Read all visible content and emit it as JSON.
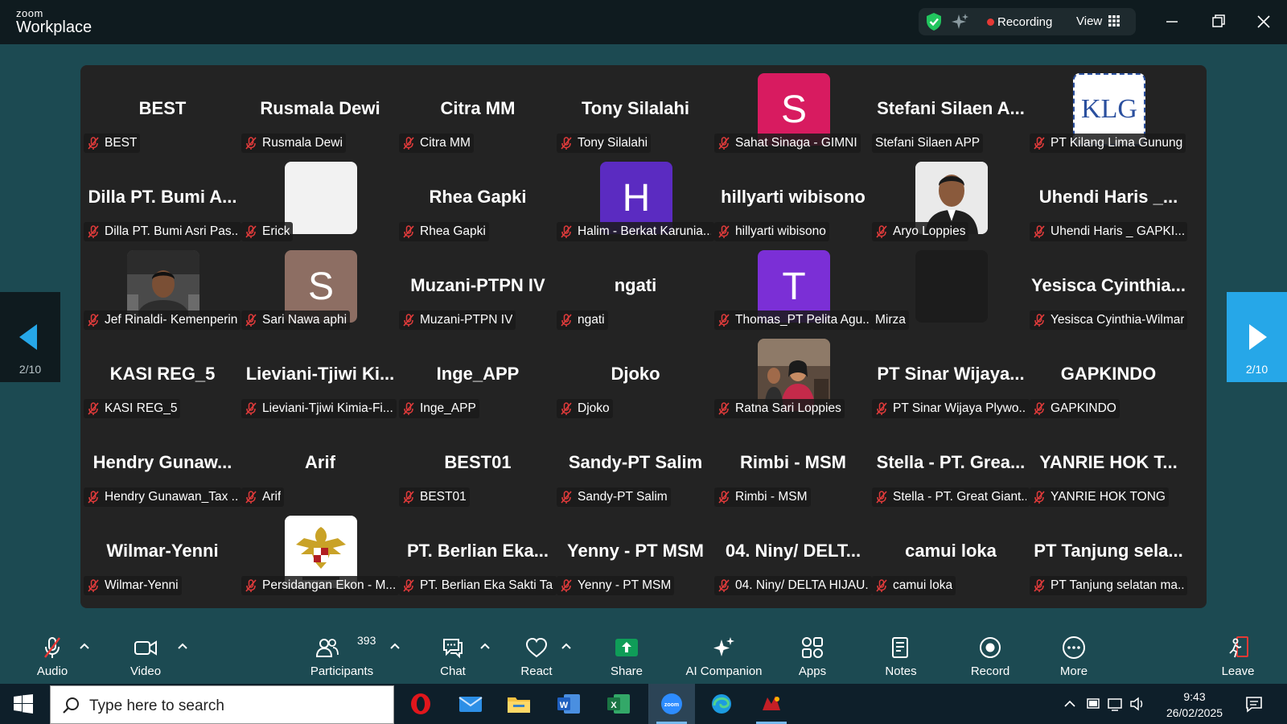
{
  "app": {
    "brand_top": "zoom",
    "brand_bottom": "Workplace"
  },
  "status": {
    "recording_label": "Recording",
    "view_label": "View"
  },
  "pager": {
    "page_left": "2/10",
    "page_right": "2/10"
  },
  "tiles": [
    {
      "big": "BEST",
      "tag": "BEST"
    },
    {
      "big": "Rusmala Dewi",
      "tag": "Rusmala Dewi"
    },
    {
      "big": "Citra MM",
      "tag": "Citra MM"
    },
    {
      "big": "Tony Silalahi",
      "tag": "Tony Silalahi"
    },
    {
      "avatar": "S",
      "avatar_color": "#d81b60",
      "tag": "Sahat Sinaga - GIMNI"
    },
    {
      "big": "Stefani Silaen A...",
      "tag": "Stefani Silaen APP",
      "nomic": true
    },
    {
      "avatar": "KLG",
      "avatar_color": "#ffffff",
      "avatar_text_color": "#2a4f9e",
      "tag": "PT Kilang Lima Gunung"
    },
    {
      "big": "Dilla PT. Bumi A...",
      "tag": "Dilla PT. Bumi Asri Pas..."
    },
    {
      "avatar": "",
      "avatar_color": "#f2f2f2",
      "tag": "Erick"
    },
    {
      "big": "Rhea Gapki",
      "tag": "Rhea Gapki"
    },
    {
      "avatar": "H",
      "avatar_color": "#5b2bc1",
      "tag": "Halim - Berkat Karunia..."
    },
    {
      "big": "hillyarti wibisono",
      "tag": "hillyarti wibisono"
    },
    {
      "avatar": "",
      "avatar_color": "#d9d9d9",
      "photo": "person",
      "tag": "Aryo Loppies"
    },
    {
      "big": "Uhendi Haris _...",
      "tag": "Uhendi Haris _ GAPKI..."
    },
    {
      "avatar": "",
      "avatar_color": "#5a5a5a",
      "photo": "car",
      "tag": "Jef Rinaldi- Kemenperin"
    },
    {
      "avatar": "S",
      "avatar_color": "#8d6e63",
      "tag": "Sari Nawa aphi"
    },
    {
      "big": "Muzani-PTPN IV",
      "tag": "Muzani-PTPN IV"
    },
    {
      "big": "ngati",
      "tag": "ngati"
    },
    {
      "avatar": "T",
      "avatar_color": "#7b2fd6",
      "tag": "Thomas_PT Pelita Agu..."
    },
    {
      "avatar": "",
      "avatar_color": "#1c1c1c",
      "tag": "Mirza",
      "nomic": true
    },
    {
      "big": "Yesisca Cyinthia...",
      "tag": "Yesisca Cyinthia-Wilmar"
    },
    {
      "big": "KASI REG_5",
      "tag": "KASI REG_5"
    },
    {
      "big": "Lieviani-Tjiwi Ki...",
      "tag": "Lieviani-Tjiwi Kimia-Fi..."
    },
    {
      "big": "Inge_APP",
      "tag": "Inge_APP"
    },
    {
      "big": "Djoko",
      "tag": "Djoko"
    },
    {
      "avatar": "",
      "avatar_color": "#6d5848",
      "photo": "group",
      "tag": "Ratna Sari Loppies"
    },
    {
      "big": "PT Sinar Wijaya...",
      "tag": "PT Sinar Wijaya Plywo..."
    },
    {
      "big": "GAPKINDO",
      "tag": "GAPKINDO"
    },
    {
      "big": "Hendry Gunaw...",
      "tag": "Hendry Gunawan_Tax ..."
    },
    {
      "big": "Arif",
      "tag": "Arif"
    },
    {
      "big": "BEST01",
      "tag": "BEST01"
    },
    {
      "big": "Sandy-PT Salim",
      "tag": "Sandy-PT Salim"
    },
    {
      "big": "Rimbi - MSM",
      "tag": "Rimbi - MSM"
    },
    {
      "big": "Stella - PT. Grea...",
      "tag": "Stella - PT. Great Giant..."
    },
    {
      "big": "YANRIE HOK T...",
      "tag": "YANRIE HOK TONG"
    },
    {
      "big": "Wilmar-Yenni",
      "tag": "Wilmar-Yenni"
    },
    {
      "avatar": "",
      "avatar_color": "#ffffff",
      "photo": "garuda",
      "tag": "Persidangan Ekon - M..."
    },
    {
      "big": "PT. Berlian Eka...",
      "tag": "PT. Berlian Eka Sakti Ta..."
    },
    {
      "big": "Yenny - PT MSM",
      "tag": "Yenny - PT MSM"
    },
    {
      "big": "04. Niny/ DELT...",
      "tag": "04. Niny/ DELTA HIJAU..."
    },
    {
      "big": "camui loka",
      "tag": "camui loka"
    },
    {
      "big": "PT Tanjung sela...",
      "tag": "PT Tanjung selatan ma..."
    }
  ],
  "toolbar": {
    "audio": "Audio",
    "video": "Video",
    "participants_count": "393",
    "participants": "Participants",
    "chat": "Chat",
    "react": "React",
    "share": "Share",
    "ai_companion": "AI Companion",
    "apps": "Apps",
    "notes": "Notes",
    "record": "Record",
    "more": "More",
    "leave": "Leave"
  },
  "taskbar": {
    "search_placeholder": "Type here to search",
    "time": "9:43",
    "date": "26/02/2025"
  },
  "colors": {
    "share_green": "#0f9d58",
    "recording_red": "#e53935",
    "pager_blue": "#26a7e8"
  }
}
